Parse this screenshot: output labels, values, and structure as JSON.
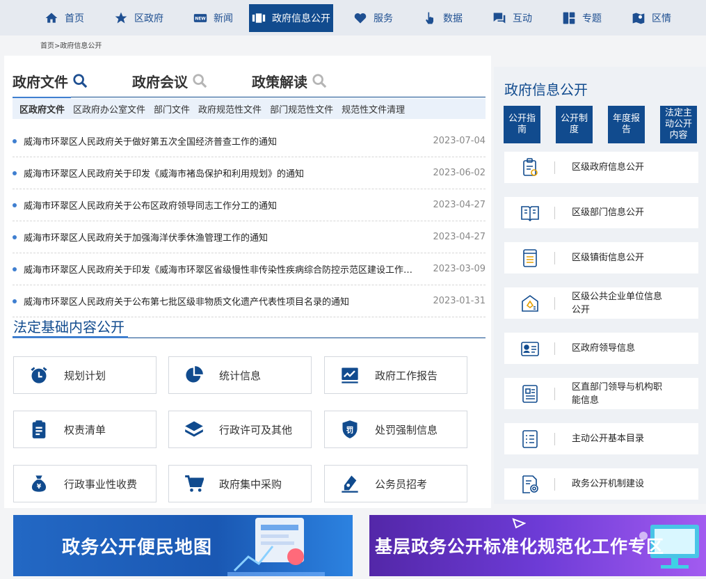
{
  "nav": {
    "items": [
      {
        "label": "首页",
        "icon": "home-icon"
      },
      {
        "label": "区政府",
        "icon": "star-icon"
      },
      {
        "label": "新闻",
        "icon": "new-badge-icon"
      },
      {
        "label": "政府信息公开",
        "icon": "info-open-icon",
        "active": true
      },
      {
        "label": "服务",
        "icon": "heart-icon"
      },
      {
        "label": "数据",
        "icon": "hand-pointer-icon"
      },
      {
        "label": "互动",
        "icon": "chat-icon"
      },
      {
        "label": "专题",
        "icon": "grid-icon"
      },
      {
        "label": "区情",
        "icon": "map-pin-icon"
      }
    ]
  },
  "breadcrumb": "首页>政府信息公开",
  "docs": {
    "tabs": [
      "政府文件",
      "政府会议",
      "政策解读"
    ],
    "subtabs": [
      "区政府文件",
      "区政府办公室文件",
      "部门文件",
      "政府规范性文件",
      "部门规范性文件",
      "规范性文件清理"
    ],
    "rows": [
      {
        "title": "威海市环翠区人民政府关于做好第五次全国经济普查工作的通知",
        "date": "2023-07-04"
      },
      {
        "title": "威海市环翠区人民政府关于印发《威海市褚岛保护和利用规划》的通知",
        "date": "2023-06-02"
      },
      {
        "title": "威海市环翠区人民政府关于公布区政府领导同志工作分工的通知",
        "date": "2023-04-27"
      },
      {
        "title": "威海市环翠区人民政府关于加强海洋伏季休渔管理工作的通知",
        "date": "2023-04-27"
      },
      {
        "title": "威海市环翠区人民政府关于印发《威海市环翠区省级慢性非传染性疾病综合防控示范区建设工作实施方案》的通知",
        "date": "2023-03-09"
      },
      {
        "title": "威海市环翠区人民政府关于公布第七批区级非物质文化遗产代表性项目名录的通知",
        "date": "2023-01-31"
      }
    ]
  },
  "fading": {
    "title": "法定基础内容公开",
    "cards": [
      {
        "label": "规划计划",
        "icon": "alarm-clock-icon"
      },
      {
        "label": "统计信息",
        "icon": "pie-chart-icon"
      },
      {
        "label": "政府工作报告",
        "icon": "trend-chart-icon"
      },
      {
        "label": "权责清单",
        "icon": "clipboard-icon"
      },
      {
        "label": "行政许可及其他",
        "icon": "layers-icon"
      },
      {
        "label": "处罚强制信息",
        "icon": "shield-penalty-icon"
      },
      {
        "label": "行政事业性收费",
        "icon": "money-bag-icon"
      },
      {
        "label": "政府集中采购",
        "icon": "cart-icon"
      },
      {
        "label": "公务员招考",
        "icon": "pen-icon"
      }
    ]
  },
  "right": {
    "title": "政府信息公开",
    "quick": [
      "公开指南",
      "公开制度",
      "年度报告",
      "法定主动公开内容"
    ],
    "list": [
      {
        "label": "区级政府信息公开",
        "icon": "clipboard-check-icon"
      },
      {
        "label": "区级部门信息公开",
        "icon": "open-book-icon"
      },
      {
        "label": "区级镇街信息公开",
        "icon": "document-list-icon"
      },
      {
        "label": "区级公共企业单位信息公开",
        "icon": "star-badge-icon"
      },
      {
        "label": "区政府领导信息",
        "icon": "id-card-icon"
      },
      {
        "label": "区直部门领导与机构职能信息",
        "icon": "profile-doc-icon"
      },
      {
        "label": "主动公开基本目录",
        "icon": "checklist-icon"
      },
      {
        "label": "政务公开机制建设",
        "icon": "gear-doc-icon"
      }
    ]
  },
  "banners": [
    "政务公开便民地图",
    "基层政务公开标准化规范化工作专区"
  ]
}
